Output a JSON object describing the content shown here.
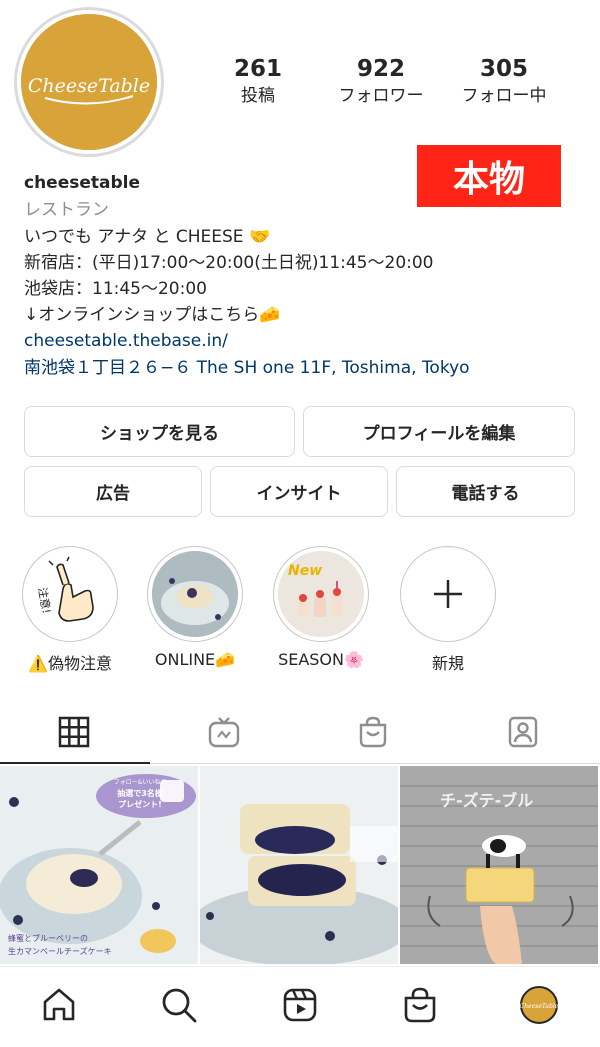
{
  "profile": {
    "avatar_text": "CheeseTable",
    "username": "cheesetable",
    "category": "レストラン",
    "bio_lines": [
      "いつでも アナタ と CHEESE 🤝",
      "新宿店：(平日)17:00〜20:00(土日祝)11:45〜20:00",
      "池袋店：11:45〜20:00",
      "↓オンラインショップはこちら🧀"
    ],
    "website": "cheesetable.thebase.in/",
    "address": "南池袋１丁目２６−６ The SH one 11F, Toshima, Tokyo",
    "badge": "本物"
  },
  "stats": {
    "posts": {
      "value": "261",
      "label": "投稿"
    },
    "followers": {
      "value": "922",
      "label": "フォロワー"
    },
    "following": {
      "value": "305",
      "label": "フォロー中"
    }
  },
  "actions": {
    "view_shop": "ショップを見る",
    "edit_profile": "プロフィールを編集",
    "ads": "広告",
    "insights": "インサイト",
    "call": "電話する"
  },
  "highlights": [
    {
      "label": "⚠️偽物注意",
      "cover_text": "注意!"
    },
    {
      "label": "ONLINE🧀"
    },
    {
      "label": "SEASON🌸",
      "cover_text": "New"
    },
    {
      "label": "新規"
    }
  ],
  "posts": [
    {
      "banner_top": "フォロー&いいねで",
      "banner_main": "抽選で3名様\nプレゼント!",
      "caption_1": "蜂蜜とブルーベリーの",
      "caption_2": "生カマンベールチーズケーキ"
    },
    {},
    {
      "sign_text": "チ-ズテ-ブル"
    }
  ],
  "colors": {
    "avatar_bg": "#d8a43a",
    "badge_bg": "#ff2416",
    "link": "#00376b",
    "border": "#dbdbdb"
  },
  "icons": {
    "tabs": [
      "grid-icon",
      "igtv-icon",
      "shop-bag-icon",
      "tagged-icon"
    ],
    "nav": [
      "home-icon",
      "search-icon",
      "reels-icon",
      "shop-icon",
      "profile-avatar-icon"
    ],
    "new_highlight": "plus-icon"
  }
}
